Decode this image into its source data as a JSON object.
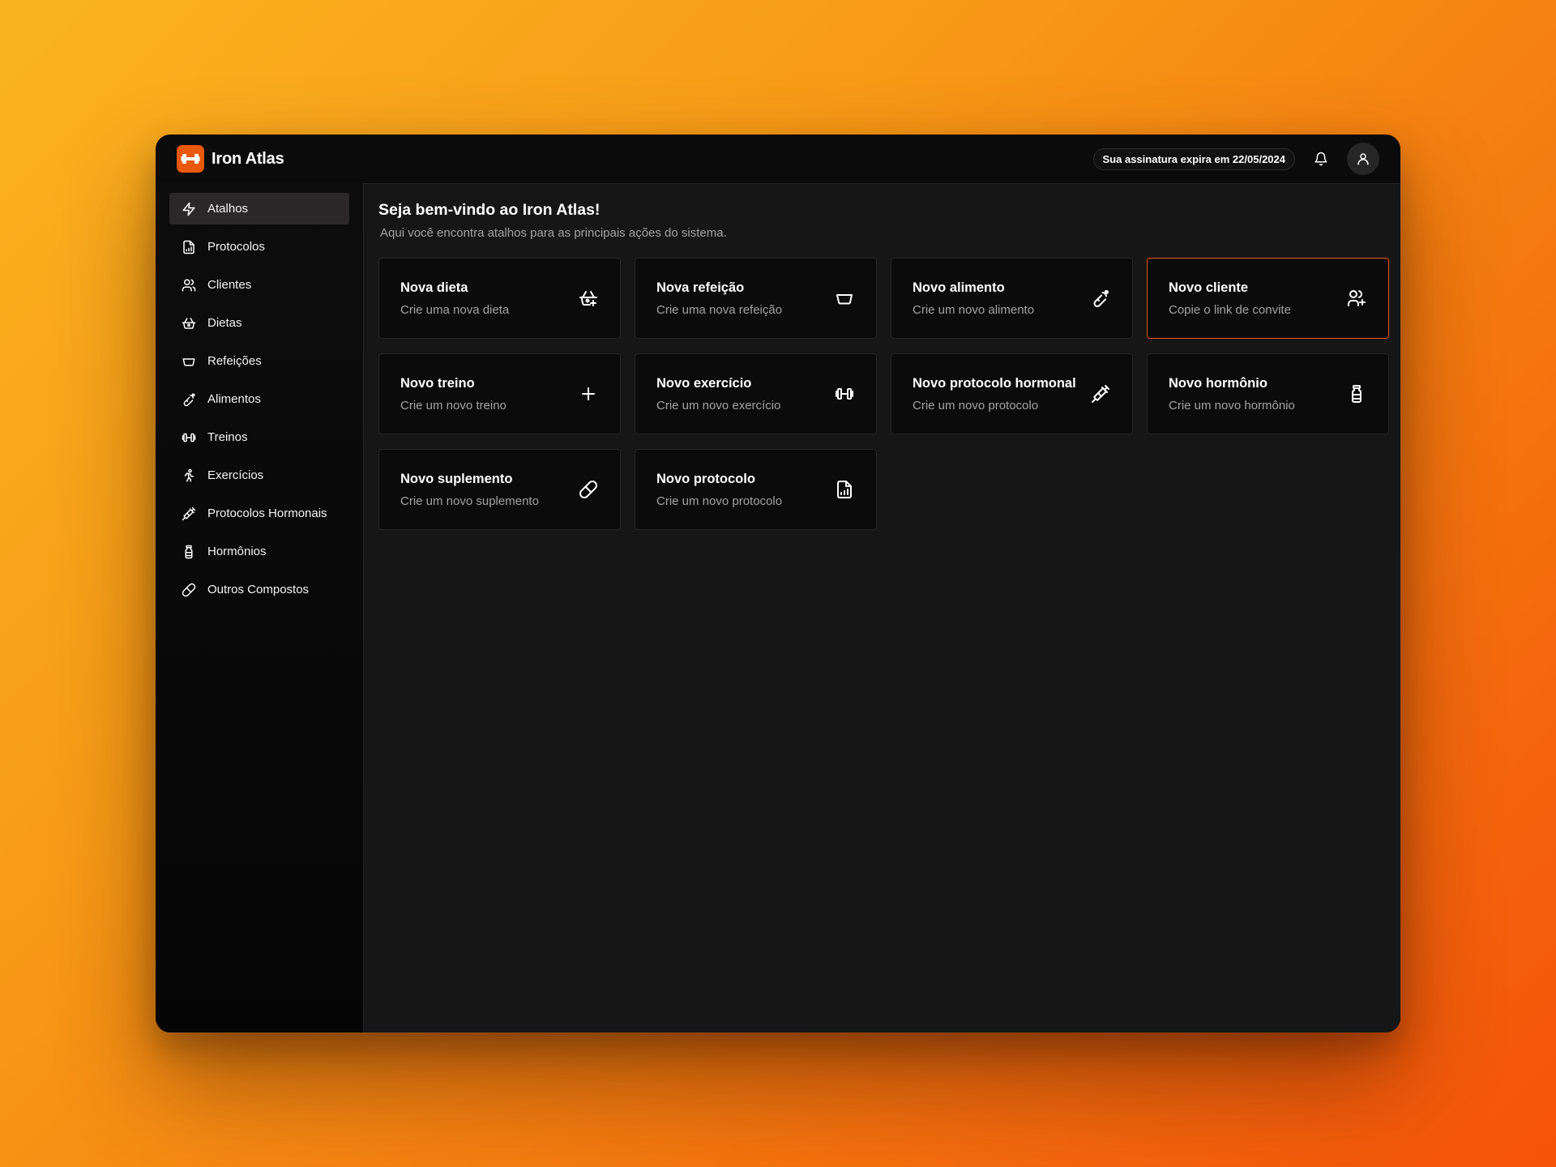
{
  "app": {
    "name": "Iron Atlas"
  },
  "header": {
    "subscription": "Sua assinatura expira em 22/05/2024",
    "bell_icon": "bell-icon",
    "avatar_icon": "user-icon"
  },
  "sidebar": {
    "items": [
      {
        "label": "Atalhos",
        "icon": "zap-icon",
        "active": true
      },
      {
        "label": "Protocolos",
        "icon": "file-chart-icon"
      },
      {
        "label": "Clientes",
        "icon": "users-icon"
      },
      {
        "label": "Dietas",
        "icon": "basket-icon"
      },
      {
        "label": "Refeições",
        "icon": "bowl-icon"
      },
      {
        "label": "Alimentos",
        "icon": "ham-icon"
      },
      {
        "label": "Treinos",
        "icon": "dumbbell-icon"
      },
      {
        "label": "Exercícios",
        "icon": "running-icon"
      },
      {
        "label": "Protocolos Hormonais",
        "icon": "syringe-icon"
      },
      {
        "label": "Hormônios",
        "icon": "vial-icon"
      },
      {
        "label": "Outros Compostos",
        "icon": "pill-icon"
      }
    ]
  },
  "main": {
    "title": "Seja bem-vindo ao Iron Atlas!",
    "subtitle": "Aqui você encontra atalhos para as principais ações do sistema.",
    "cards": [
      {
        "title": "Nova dieta",
        "desc": "Crie uma nova dieta",
        "icon": "basket-plus-icon"
      },
      {
        "title": "Nova refeição",
        "desc": "Crie uma nova refeição",
        "icon": "bowl-icon"
      },
      {
        "title": "Novo alimento",
        "desc": "Crie um novo alimento",
        "icon": "ham-icon"
      },
      {
        "title": "Novo cliente",
        "desc": "Copie o link de convite",
        "icon": "user-plus-icon",
        "highlight": true
      },
      {
        "title": "Novo treino",
        "desc": "Crie um novo treino",
        "icon": "plus-icon"
      },
      {
        "title": "Novo exercício",
        "desc": "Crie um novo exercício",
        "icon": "dumbbell-icon"
      },
      {
        "title": "Novo protocolo hormonal",
        "desc": "Crie um novo protocolo",
        "icon": "syringe-icon"
      },
      {
        "title": "Novo hormônio",
        "desc": "Crie um novo hormônio",
        "icon": "vial-icon"
      },
      {
        "title": "Novo suplemento",
        "desc": "Crie um novo suplemento",
        "icon": "pill-icon"
      },
      {
        "title": "Novo protocolo",
        "desc": "Crie um novo protocolo",
        "icon": "file-chart-icon"
      }
    ]
  },
  "colors": {
    "accent": "#ea580c",
    "background": "#0b0b0b",
    "panel": "#161616"
  }
}
